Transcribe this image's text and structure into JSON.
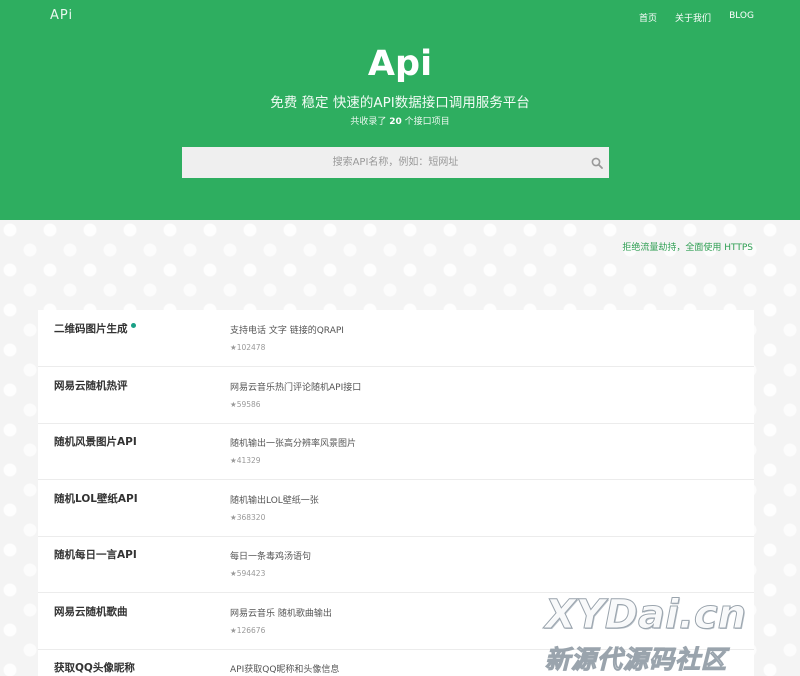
{
  "header": {
    "brand": "APi",
    "nav": [
      "首页",
      "关于我们",
      "BLOG"
    ]
  },
  "hero": {
    "title": "Api",
    "subtitle": "免费 稳定 快速的API数据接口调用服务平台",
    "count_prefix": "共收录了",
    "count_value": "20",
    "count_suffix": "个接口项目"
  },
  "search": {
    "placeholder": "搜索API名称，例如：短网址",
    "icon": "search-icon"
  },
  "notice": "拒绝流量劫持，全面使用 HTTPS",
  "apis": [
    {
      "name": "二维码图片生成",
      "desc": "支持电话 文字 链接的QRAPI",
      "stars": "★102478",
      "new": true
    },
    {
      "name": "网易云随机热评",
      "desc": "网易云音乐热门评论随机API接口",
      "stars": "★59586",
      "new": false
    },
    {
      "name": "随机风景图片API",
      "desc": "随机输出一张高分辨率风景图片",
      "stars": "★41329",
      "new": false
    },
    {
      "name": "随机LOL壁纸API",
      "desc": "随机输出LOL壁纸一张",
      "stars": "★368320",
      "new": false
    },
    {
      "name": "随机每日一言API",
      "desc": "每日一条毒鸡汤语句",
      "stars": "★594423",
      "new": false
    },
    {
      "name": "网易云随机歌曲",
      "desc": "网易云音乐 随机歌曲输出",
      "stars": "★126676",
      "new": false
    },
    {
      "name": "获取QQ头像昵称",
      "desc": "API获取QQ昵称和头像信息",
      "stars": "",
      "new": false
    }
  ],
  "watermark": {
    "line1": "XYDai.cn",
    "line2": "新源代源码社区"
  },
  "colors": {
    "accent": "#2eae60",
    "dot": "#1aa086"
  }
}
